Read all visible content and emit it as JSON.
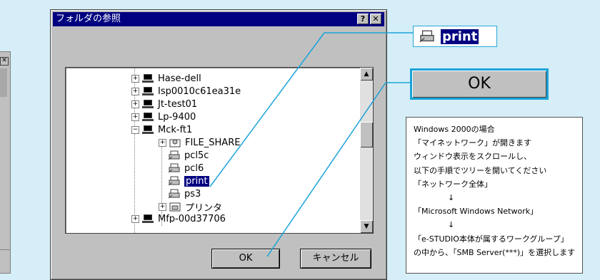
{
  "dialog": {
    "title": "フォルダの参照",
    "help_label": "?",
    "close_label": "✕",
    "ok_label": "OK",
    "cancel_label": "キャンセル"
  },
  "tree": {
    "items": [
      {
        "label": "Hase-dell",
        "type": "computer",
        "expander": "+"
      },
      {
        "label": "Isp0010c61ea31e",
        "type": "computer",
        "expander": "+"
      },
      {
        "label": "Jt-test01",
        "type": "computer",
        "expander": "+"
      },
      {
        "label": "Lp-9400",
        "type": "computer",
        "expander": "+"
      },
      {
        "label": "Mck-ft1",
        "type": "computer",
        "expander": "−"
      },
      {
        "label": "FILE_SHARE",
        "type": "share",
        "expander": "+"
      },
      {
        "label": "pcl5c",
        "type": "printer"
      },
      {
        "label": "pcl6",
        "type": "printer"
      },
      {
        "label": "print",
        "type": "printer",
        "selected": true
      },
      {
        "label": "ps3",
        "type": "printer"
      },
      {
        "label": "プリンタ",
        "type": "printers-folder",
        "expander": "+"
      },
      {
        "label": "Mfp-00d37706",
        "type": "computer",
        "expander": "+"
      }
    ]
  },
  "callouts": {
    "print_label": "print",
    "ok_label": "OK"
  },
  "note": {
    "line1": "Windows 2000の場合",
    "line2": "「マイネットワーク」が開きます",
    "line3": "ウィンドウ表示をスクロールし、",
    "line4": "以下の手順でツリーを開いてください",
    "line5": "「ネットワーク全体」",
    "arrow1": "↓",
    "line6": "「Microsoft Windows Network」",
    "arrow2": "↓",
    "line7": "「e-STUDIO本体が属するワークグループ」",
    "line8": "の中から、「SMB Server(***)」を選択します"
  },
  "colors": {
    "background": "#d5eef7",
    "accent": "#1aa3d8",
    "titlebar": "#000080",
    "selection": "#000080"
  }
}
